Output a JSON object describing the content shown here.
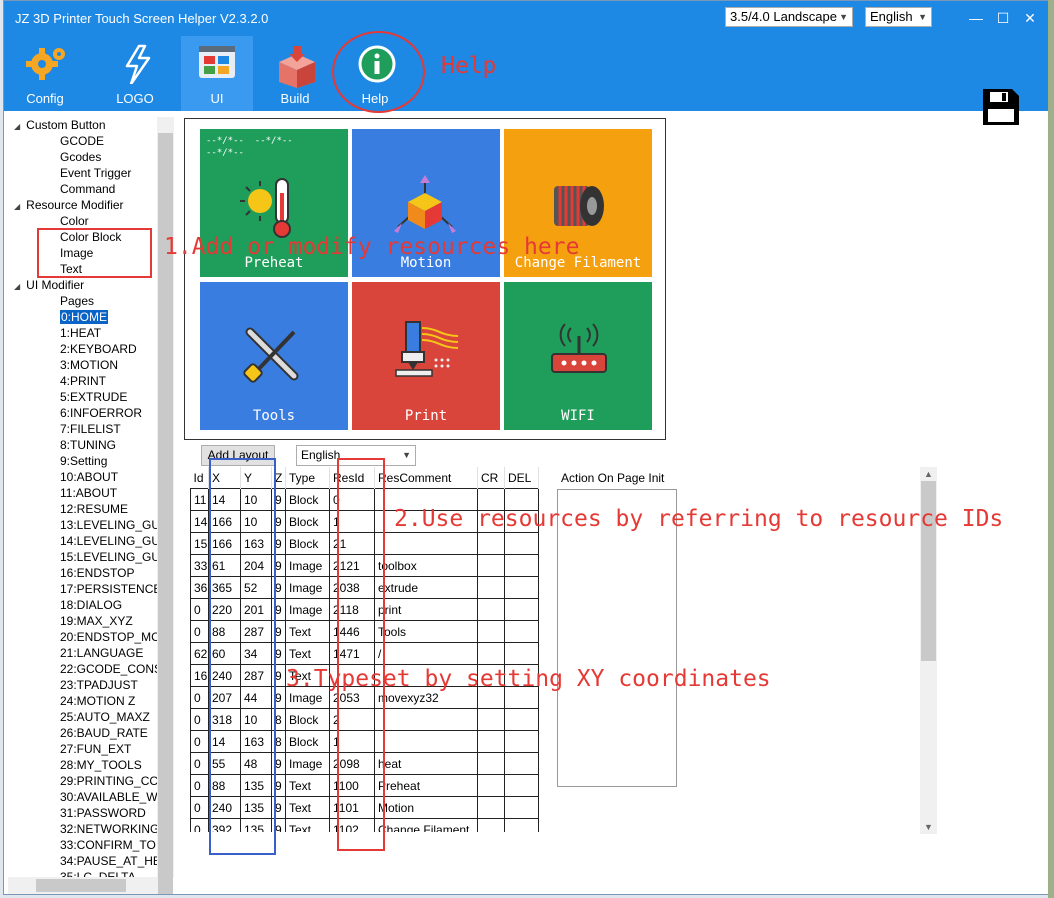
{
  "window": {
    "title": "JZ 3D Printer Touch Screen Helper  V2.3.2.0",
    "screen_select": "3.5/4.0 Landscape",
    "language_select": "English",
    "buttons": {
      "minimize": "—",
      "maximize": "☐",
      "close": "✕"
    }
  },
  "toolbar": {
    "items": [
      {
        "label": "Config",
        "icon": "gear-icon"
      },
      {
        "label": "LOGO",
        "icon": "lightning-icon"
      },
      {
        "label": "UI",
        "icon": "layout-icon",
        "selected": true
      },
      {
        "label": "Build",
        "icon": "box-icon"
      },
      {
        "label": "Help",
        "icon": "info-icon"
      }
    ],
    "help_annotation": "Help",
    "save_icon": "floppy-disk-icon"
  },
  "tree": {
    "groups": [
      {
        "label": "Custom Button",
        "children": [
          "GCODE",
          "Gcodes",
          "Event Trigger",
          "Command"
        ]
      },
      {
        "label": "Resource Modifier",
        "children": [
          "Color",
          "Color Block",
          "Image",
          "Text"
        ]
      },
      {
        "label": "UI Modifier",
        "children": [
          "Pages",
          "0:HOME",
          "1:HEAT",
          "2:KEYBOARD",
          "3:MOTION",
          "4:PRINT",
          "5:EXTRUDE",
          "6:INFOERROR",
          "7:FILELIST",
          "8:TUNING",
          "9:Setting",
          "10:ABOUT",
          "11:ABOUT",
          "12:RESUME",
          "13:LEVELING_GU",
          "14:LEVELING_GU",
          "15:LEVELING_GU",
          "16:ENDSTOP",
          "17:PERSISTENCE",
          "18:DIALOG",
          "19:MAX_XYZ",
          "20:ENDSTOP_MC",
          "21:LANGUAGE",
          "22:GCODE_CONS",
          "23:TPADJUST",
          "24:MOTION Z",
          "25:AUTO_MAXZ",
          "26:BAUD_RATE",
          "27:FUN_EXT",
          "28:MY_TOOLS",
          "29:PRINTING_CC",
          "30:AVAILABLE_W",
          "31:PASSWORD",
          "32:NETWORKING",
          "33:CONFIRM_TO",
          "34:PAUSE_AT_HE",
          "35:LC_DELTA"
        ]
      }
    ],
    "selected": "0:HOME"
  },
  "preview": {
    "tiles": [
      {
        "label": "Preheat",
        "color": "#1e9e5a",
        "icon": "thermometer-sun-icon"
      },
      {
        "label": "Motion",
        "color": "#3a7de0",
        "icon": "cube-axes-icon"
      },
      {
        "label": "Change Filament",
        "color": "#f5a00f",
        "icon": "filament-spool-icon"
      },
      {
        "label": "Tools",
        "color": "#3a7de0",
        "icon": "wrench-screwdriver-icon"
      },
      {
        "label": "Print",
        "color": "#d9453b",
        "icon": "nozzle-icon"
      },
      {
        "label": "WIFI",
        "color": "#1e9e5a",
        "icon": "router-icon"
      }
    ],
    "tile_status": "--*/*--"
  },
  "annotations": {
    "a1": "1.Add or modify resources here",
    "a2": "2.Use resources by referring to resource IDs",
    "a3": "3.Typeset by setting XY coordinates"
  },
  "controls": {
    "add_layout": "Add Layout",
    "layout_language": "English",
    "action_label": "Action On Page Init"
  },
  "grid": {
    "headers": [
      "Id",
      "X",
      "Y",
      "Z",
      "Type",
      "ResId",
      "ResComment",
      "CR",
      "DEL"
    ],
    "rows": [
      [
        "11",
        "14",
        "10",
        "9",
        "Block",
        "0",
        "",
        "",
        ""
      ],
      [
        "14",
        "166",
        "10",
        "9",
        "Block",
        "1",
        "",
        "",
        ""
      ],
      [
        "15",
        "166",
        "163",
        "9",
        "Block",
        "21",
        "",
        "",
        ""
      ],
      [
        "33",
        "61",
        "204",
        "9",
        "Image",
        "2121",
        "toolbox",
        "",
        ""
      ],
      [
        "36",
        "365",
        "52",
        "9",
        "Image",
        "2038",
        "extrude",
        "",
        ""
      ],
      [
        "0",
        "220",
        "201",
        "9",
        "Image",
        "2118",
        "print",
        "",
        ""
      ],
      [
        "0",
        "88",
        "287",
        "9",
        "Text",
        "1446",
        "Tools",
        "",
        ""
      ],
      [
        "62",
        "60",
        "34",
        "9",
        "Text",
        "1471",
        "/",
        "",
        ""
      ],
      [
        "16",
        "240",
        "287",
        "9",
        "Text",
        "",
        "",
        "",
        ""
      ],
      [
        "0",
        "207",
        "44",
        "9",
        "Image",
        "2053",
        "movexyz32",
        "",
        ""
      ],
      [
        "0",
        "318",
        "10",
        "8",
        "Block",
        "2",
        "",
        "",
        ""
      ],
      [
        "0",
        "14",
        "163",
        "8",
        "Block",
        "1",
        "",
        "",
        ""
      ],
      [
        "0",
        "55",
        "48",
        "9",
        "Image",
        "2098",
        "heat",
        "",
        ""
      ],
      [
        "0",
        "88",
        "135",
        "9",
        "Text",
        "1100",
        "Preheat",
        "",
        ""
      ],
      [
        "0",
        "240",
        "135",
        "9",
        "Text",
        "1101",
        "Motion",
        "",
        ""
      ],
      [
        "0",
        "392",
        "135",
        "9",
        "Text",
        "1102",
        "Change Filament",
        "",
        ""
      ]
    ]
  },
  "colors": {
    "titlebar": "#1e88e5",
    "annotation_red": "#e53935",
    "annotation_blue": "#3a5fc8"
  }
}
